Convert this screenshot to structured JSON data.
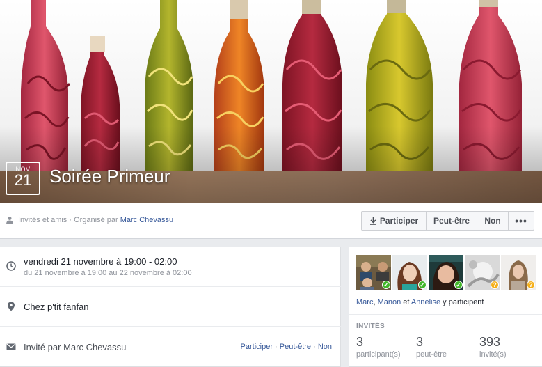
{
  "event": {
    "month": "NOV",
    "day": "21",
    "title": "Soirée Primeur"
  },
  "infobar": {
    "audience": "Invités et amis",
    "organized_prefix": "· Organisé par",
    "organizer": "Marc Chevassu"
  },
  "rsvp": {
    "participer": "Participer",
    "peut_etre": "Peut-être",
    "non": "Non",
    "more": "•••"
  },
  "details": {
    "when_main": "vendredi 21 novembre à 19:00 - 02:00",
    "when_sub": "du 21 novembre à 19:00 au 22 novembre à 02:00",
    "place": "Chez p'tit fanfan",
    "invited_by": "Invité par Marc Chevassu",
    "link_participer": "Participer",
    "sep1": " · ",
    "link_peut": "Peut-être",
    "sep2": " · ",
    "link_non": "Non"
  },
  "guests": {
    "name1": "Marc",
    "comma": ", ",
    "name2": "Manon",
    "and": " et ",
    "name3": "Annelise",
    "suffix": " y participent",
    "invites_title": "INVITÉS",
    "stats": [
      {
        "num": "3",
        "label": "participant(s)"
      },
      {
        "num": "3",
        "label": "peut-être"
      },
      {
        "num": "393",
        "label": "invité(s)"
      }
    ]
  },
  "colors": {
    "link": "#365899",
    "going_badge": "#42b72a",
    "maybe_badge": "#f5b01b"
  }
}
